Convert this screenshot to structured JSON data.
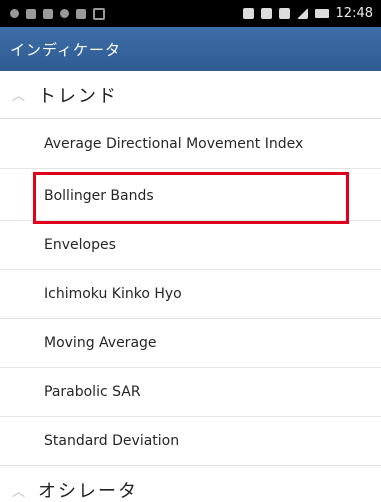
{
  "status_bar": {
    "time": "12:48"
  },
  "app_bar": {
    "title": "インディケータ"
  },
  "sections": [
    {
      "label": "トレンド",
      "items": [
        "Average Directional Movement Index",
        "Bollinger Bands",
        "Envelopes",
        "Ichimoku Kinko Hyo",
        "Moving Average",
        "Parabolic SAR",
        "Standard Deviation"
      ]
    },
    {
      "label": "オシレータ",
      "items": []
    }
  ],
  "highlighted_item": "Bollinger Bands",
  "colors": {
    "status_bar_bg": "#000000",
    "app_bar_bg": "#3467A3",
    "highlight_border": "#E0001B",
    "item_text": "#262626",
    "divider": "#E4E4E4"
  },
  "icons": {
    "section_expand": "chevron-up-icon"
  }
}
